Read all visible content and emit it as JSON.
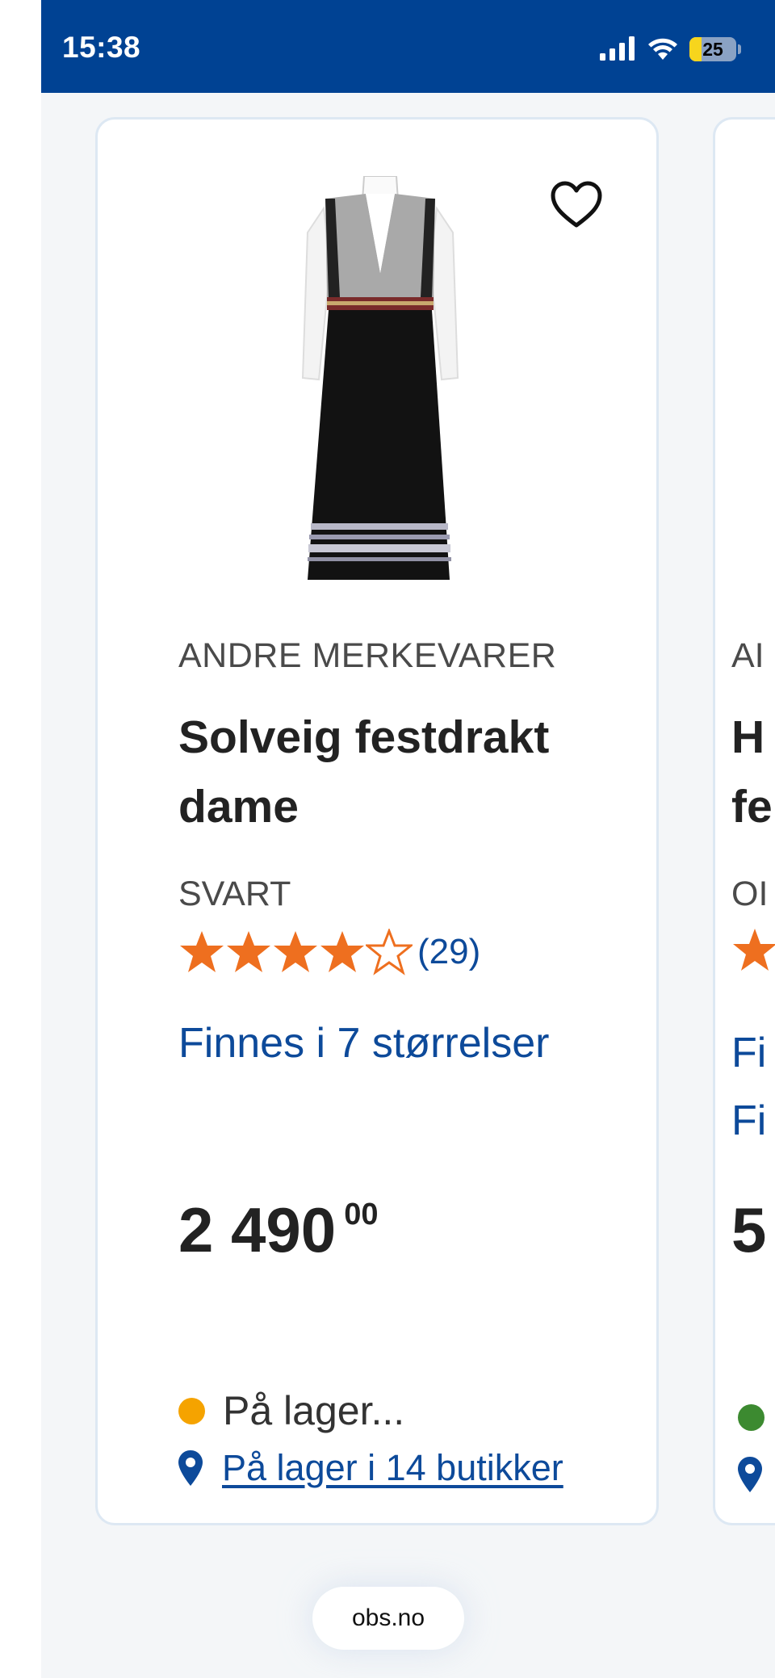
{
  "status_bar": {
    "time": "15:38",
    "battery_level": "25",
    "battery_fraction": 0.25
  },
  "colors": {
    "brand_blue": "#004293",
    "link_blue": "#0d4a9a",
    "star_orange": "#ee6f1f",
    "stock_yellow": "#f5a300",
    "stock_green": "#3c8a30"
  },
  "product": {
    "brand": "ANDRE MERKEVARER",
    "title_line1": "Solveig festdrakt",
    "title_line2": "dame",
    "color": "SVART",
    "rating": 4,
    "rating_max": 5,
    "rating_count": "(29)",
    "sizes_link": "Finnes i 7 størrelser",
    "price_main": "2 490",
    "price_decimals": "00",
    "stock_status": "På lager...",
    "stores_link": "På lager i 14 butikker",
    "favorite_icon": "heart-outline-icon"
  },
  "next_product_partial": {
    "brand": "AI",
    "title_line1": "H",
    "title_line2": "fe",
    "color": "OI",
    "sizes_line1": "Fi",
    "sizes_line2": "Fi",
    "price": "5"
  },
  "browser": {
    "url": "obs.no"
  }
}
